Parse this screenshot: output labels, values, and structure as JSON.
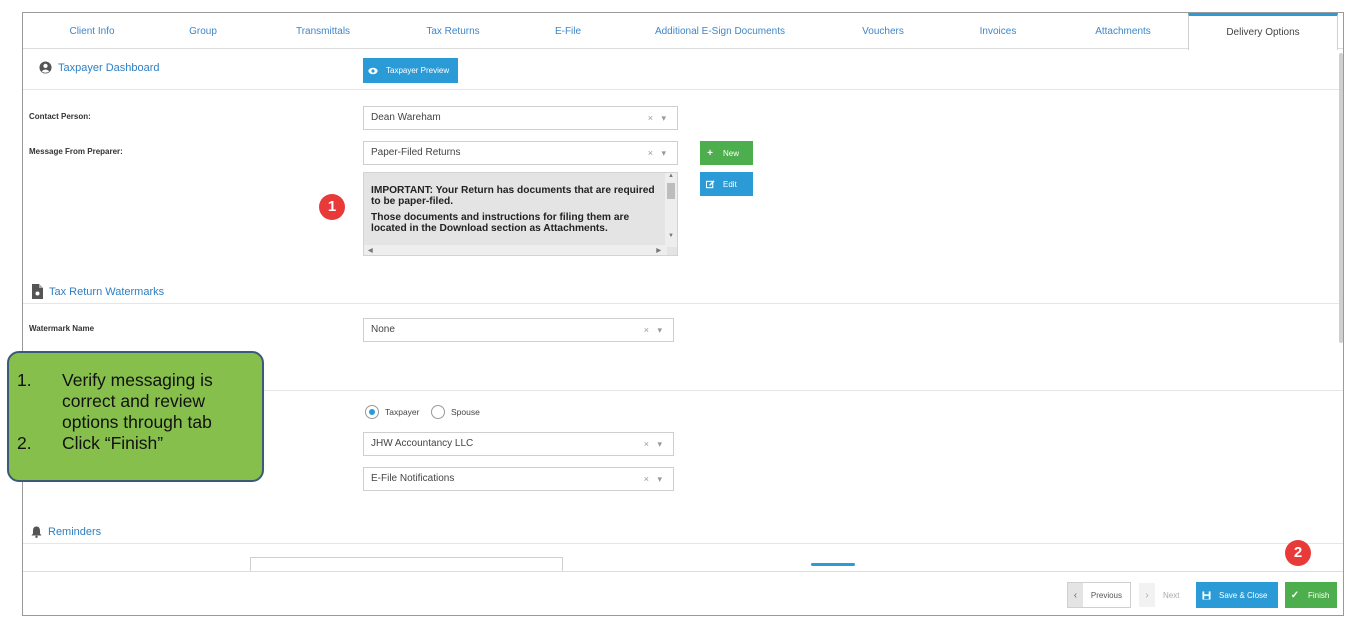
{
  "tabs": [
    {
      "label": "Client Info"
    },
    {
      "label": "Group"
    },
    {
      "label": "Transmittals"
    },
    {
      "label": "Tax Returns"
    },
    {
      "label": "E-File"
    },
    {
      "label": "Additional E-Sign Documents"
    },
    {
      "label": "Vouchers"
    },
    {
      "label": "Invoices"
    },
    {
      "label": "Attachments"
    },
    {
      "label": "Delivery Options"
    }
  ],
  "active_tab": "Delivery Options",
  "dashboard": {
    "title": "Taxpayer Dashboard",
    "preview_button": "Taxpayer Preview"
  },
  "contact": {
    "label": "Contact Person:",
    "value": "Dean Wareham"
  },
  "message": {
    "label": "Message From Preparer:",
    "value": "Paper-Filed Returns",
    "new_button": "New",
    "edit_button": "Edit",
    "body_line1": "IMPORTANT: Your Return has documents that are required to be paper-filed.",
    "body_line2": "Those documents and instructions for filing them are located in the Download section as Attachments."
  },
  "watermarks": {
    "title": "Tax Return Watermarks",
    "label": "Watermark Name",
    "value": "None"
  },
  "notifications": {
    "radio_taxpayer": "Taxpayer",
    "radio_spouse": "Spouse",
    "selected": "Taxpayer",
    "sender_value": "JHW Accountancy LLC",
    "type_value": "E-File Notifications"
  },
  "reminders": {
    "title": "Reminders"
  },
  "badges": {
    "one": "1",
    "two": "2"
  },
  "callout": {
    "item1_num": "1.",
    "item1_text": "Verify messaging is correct and review options through tab",
    "item2_num": "2.",
    "item2_text": "Click “Finish”"
  },
  "footer": {
    "previous": "Previous",
    "next": "Next",
    "save_close": "Save & Close",
    "finish": "Finish"
  },
  "colors": {
    "link_blue": "#2f7fc1",
    "button_blue": "#2a9bd6",
    "button_green": "#4cae4c",
    "callout_green": "#86bf4c",
    "badge_red": "#e93a3a"
  }
}
